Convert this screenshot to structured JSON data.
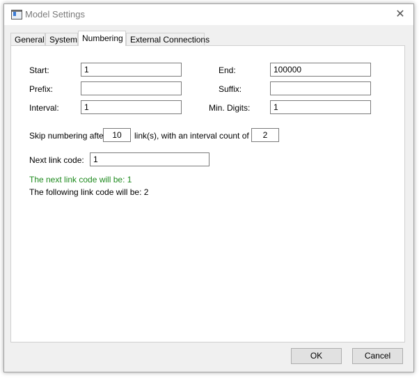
{
  "window": {
    "title": "Model Settings",
    "close_glyph": "✕"
  },
  "tabs": [
    {
      "label": "General",
      "active": false
    },
    {
      "label": "System",
      "active": false
    },
    {
      "label": "Numbering",
      "active": true
    },
    {
      "label": "External Connections",
      "active": false
    }
  ],
  "numbering": {
    "start_label": "Start:",
    "start_value": "1",
    "end_label": "End:",
    "end_value": "100000",
    "prefix_label": "Prefix:",
    "prefix_value": "",
    "suffix_label": "Suffix:",
    "suffix_value": "",
    "interval_label": "Interval:",
    "interval_value": "1",
    "min_digits_label": "Min. Digits:",
    "min_digits_value": "1",
    "skip_label_before": "Skip numbering after",
    "skip_value": "10",
    "skip_label_middle": "link(s), with an interval count of",
    "skip_interval_value": "2",
    "next_link_label": "Next link code:",
    "next_link_value": "1",
    "next_code_message": "The next link code will be: 1",
    "following_code_message": "The following link code will be: 2"
  },
  "buttons": {
    "ok_label": "OK",
    "cancel_label": "Cancel"
  },
  "colors": {
    "message_green": "#1e8a1e"
  },
  "icons": {
    "app": "app-window-icon",
    "close": "close-icon"
  }
}
